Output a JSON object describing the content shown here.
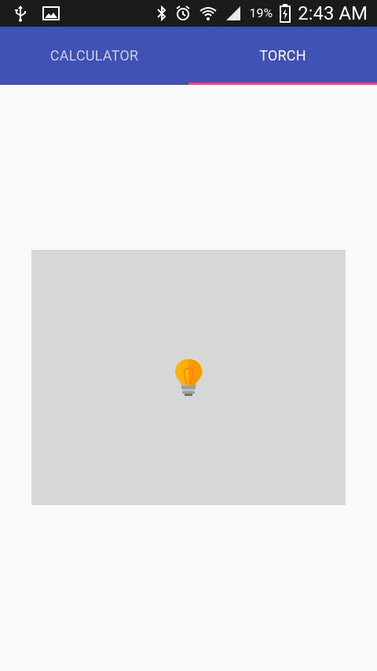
{
  "status_bar": {
    "left_icons": [
      "usb-icon",
      "image-icon"
    ],
    "right_icons": [
      "bluetooth-icon",
      "alarm-icon",
      "wifi-icon",
      "signal-icon",
      "battery-icon"
    ],
    "battery_percent": "19%",
    "time": "2:43 AM"
  },
  "tabs": {
    "items": [
      {
        "label": "CALCULATOR",
        "selected": false
      },
      {
        "label": "TORCH",
        "selected": true
      }
    ],
    "colors": {
      "appbar": "#3f51b5",
      "indicator": "#ff4081"
    }
  },
  "torch": {
    "icon": "lightbulb-icon",
    "panel_color": "#d6d8d8",
    "bulb_color": "#ffb300"
  }
}
